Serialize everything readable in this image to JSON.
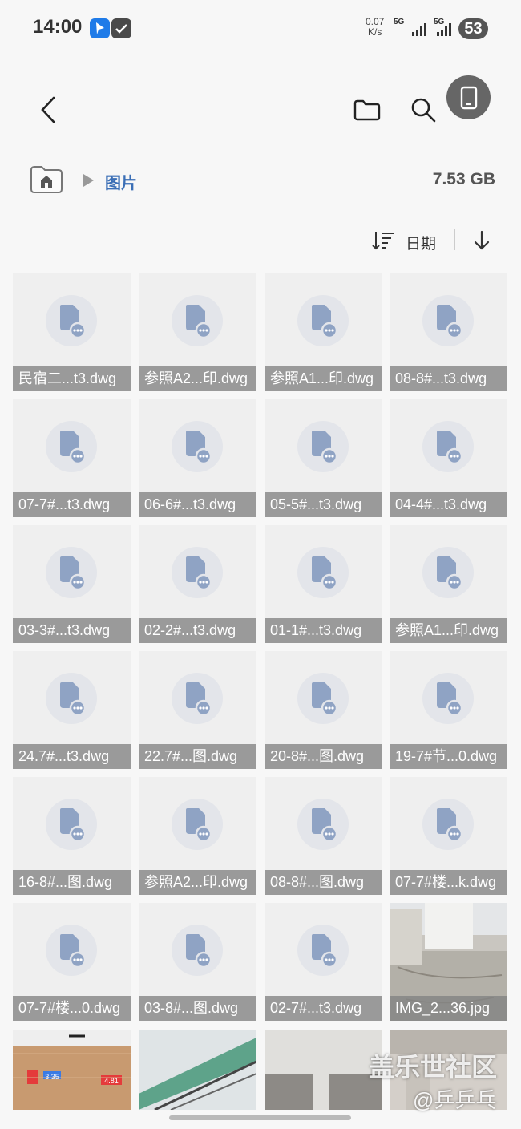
{
  "status_bar": {
    "time": "14:00",
    "net_speed_value": "0.07",
    "net_speed_unit": "K/s",
    "signal1": "5G",
    "signal2": "5G",
    "battery": "53"
  },
  "breadcrumb": {
    "current": "图片",
    "storage": "7.53 GB"
  },
  "sort": {
    "label": "日期"
  },
  "files": [
    {
      "name": "民宿二...t3.dwg",
      "type": "doc"
    },
    {
      "name": "参照A2...印.dwg",
      "type": "doc"
    },
    {
      "name": "参照A1...印.dwg",
      "type": "doc"
    },
    {
      "name": "08-8#...t3.dwg",
      "type": "doc"
    },
    {
      "name": "07-7#...t3.dwg",
      "type": "doc"
    },
    {
      "name": "06-6#...t3.dwg",
      "type": "doc"
    },
    {
      "name": "05-5#...t3.dwg",
      "type": "doc"
    },
    {
      "name": "04-4#...t3.dwg",
      "type": "doc"
    },
    {
      "name": "03-3#...t3.dwg",
      "type": "doc"
    },
    {
      "name": "02-2#...t3.dwg",
      "type": "doc"
    },
    {
      "name": "01-1#...t3.dwg",
      "type": "doc"
    },
    {
      "name": "参照A1...印.dwg",
      "type": "doc"
    },
    {
      "name": "24.7#...t3.dwg",
      "type": "doc"
    },
    {
      "name": "22.7#...图.dwg",
      "type": "doc"
    },
    {
      "name": "20-8#...图.dwg",
      "type": "doc"
    },
    {
      "name": "19-7#节...0.dwg",
      "type": "doc"
    },
    {
      "name": "16-8#...图.dwg",
      "type": "doc"
    },
    {
      "name": "参照A2...印.dwg",
      "type": "doc"
    },
    {
      "name": "08-8#...图.dwg",
      "type": "doc"
    },
    {
      "name": "07-7#楼...k.dwg",
      "type": "doc"
    },
    {
      "name": "07-7#楼...0.dwg",
      "type": "doc"
    },
    {
      "name": "03-8#...图.dwg",
      "type": "doc"
    },
    {
      "name": "02-7#...t3.dwg",
      "type": "doc"
    },
    {
      "name": "IMG_2...36.jpg",
      "type": "photo"
    }
  ],
  "photo_row": [
    {
      "labels": [
        "3.35",
        "4.81"
      ]
    },
    {
      "labels": []
    },
    {
      "labels": []
    },
    {
      "labels": []
    }
  ],
  "watermark": {
    "line1": "盖乐世社区",
    "line2": "@乒乒乓"
  },
  "colors": {
    "accent": "#3b6fb6",
    "doc_icon": "#8fa3c4"
  }
}
